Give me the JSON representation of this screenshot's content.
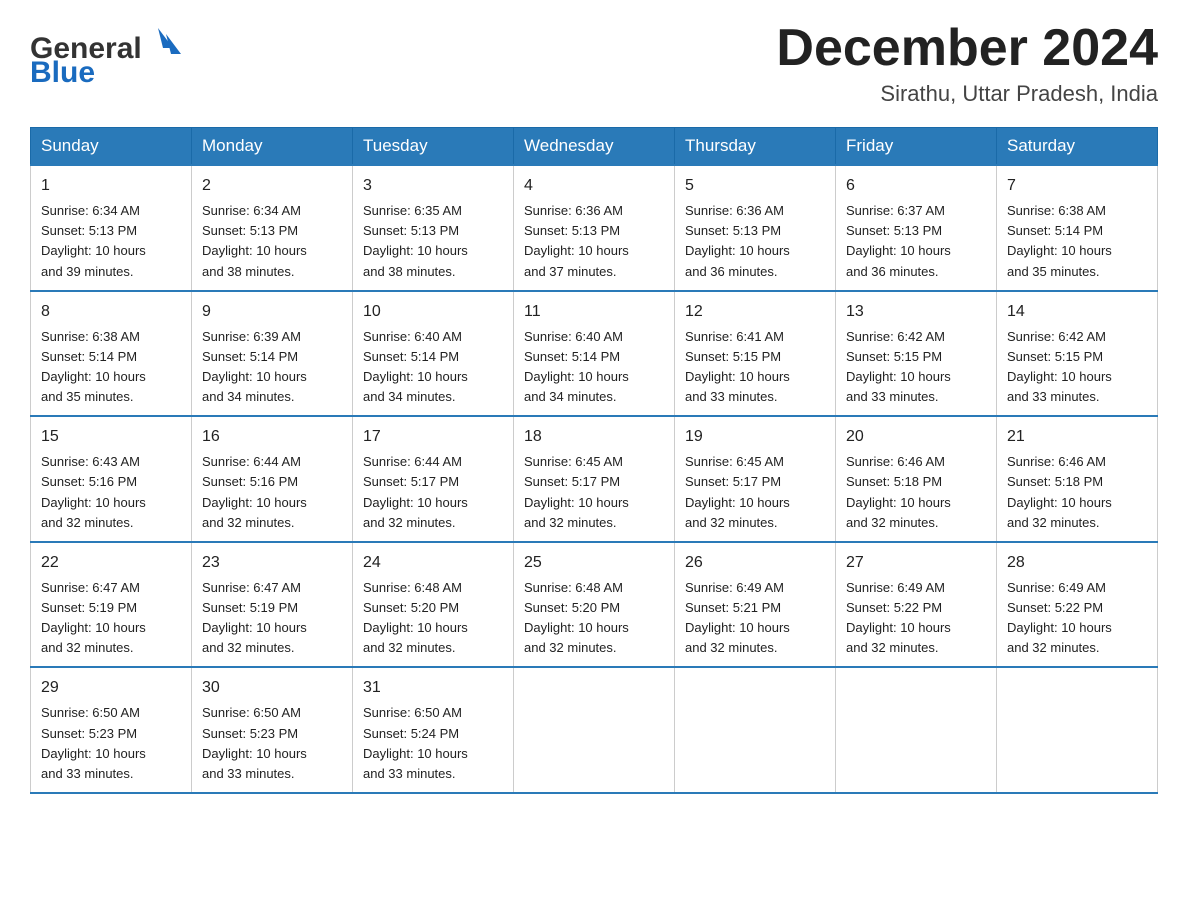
{
  "header": {
    "logo_general": "General",
    "logo_blue": "Blue",
    "month_title": "December 2024",
    "location": "Sirathu, Uttar Pradesh, India"
  },
  "days_of_week": [
    "Sunday",
    "Monday",
    "Tuesday",
    "Wednesday",
    "Thursday",
    "Friday",
    "Saturday"
  ],
  "weeks": [
    [
      {
        "day": "1",
        "sunrise": "6:34 AM",
        "sunset": "5:13 PM",
        "daylight": "10 hours and 39 minutes."
      },
      {
        "day": "2",
        "sunrise": "6:34 AM",
        "sunset": "5:13 PM",
        "daylight": "10 hours and 38 minutes."
      },
      {
        "day": "3",
        "sunrise": "6:35 AM",
        "sunset": "5:13 PM",
        "daylight": "10 hours and 38 minutes."
      },
      {
        "day": "4",
        "sunrise": "6:36 AM",
        "sunset": "5:13 PM",
        "daylight": "10 hours and 37 minutes."
      },
      {
        "day": "5",
        "sunrise": "6:36 AM",
        "sunset": "5:13 PM",
        "daylight": "10 hours and 36 minutes."
      },
      {
        "day": "6",
        "sunrise": "6:37 AM",
        "sunset": "5:13 PM",
        "daylight": "10 hours and 36 minutes."
      },
      {
        "day": "7",
        "sunrise": "6:38 AM",
        "sunset": "5:14 PM",
        "daylight": "10 hours and 35 minutes."
      }
    ],
    [
      {
        "day": "8",
        "sunrise": "6:38 AM",
        "sunset": "5:14 PM",
        "daylight": "10 hours and 35 minutes."
      },
      {
        "day": "9",
        "sunrise": "6:39 AM",
        "sunset": "5:14 PM",
        "daylight": "10 hours and 34 minutes."
      },
      {
        "day": "10",
        "sunrise": "6:40 AM",
        "sunset": "5:14 PM",
        "daylight": "10 hours and 34 minutes."
      },
      {
        "day": "11",
        "sunrise": "6:40 AM",
        "sunset": "5:14 PM",
        "daylight": "10 hours and 34 minutes."
      },
      {
        "day": "12",
        "sunrise": "6:41 AM",
        "sunset": "5:15 PM",
        "daylight": "10 hours and 33 minutes."
      },
      {
        "day": "13",
        "sunrise": "6:42 AM",
        "sunset": "5:15 PM",
        "daylight": "10 hours and 33 minutes."
      },
      {
        "day": "14",
        "sunrise": "6:42 AM",
        "sunset": "5:15 PM",
        "daylight": "10 hours and 33 minutes."
      }
    ],
    [
      {
        "day": "15",
        "sunrise": "6:43 AM",
        "sunset": "5:16 PM",
        "daylight": "10 hours and 32 minutes."
      },
      {
        "day": "16",
        "sunrise": "6:44 AM",
        "sunset": "5:16 PM",
        "daylight": "10 hours and 32 minutes."
      },
      {
        "day": "17",
        "sunrise": "6:44 AM",
        "sunset": "5:17 PM",
        "daylight": "10 hours and 32 minutes."
      },
      {
        "day": "18",
        "sunrise": "6:45 AM",
        "sunset": "5:17 PM",
        "daylight": "10 hours and 32 minutes."
      },
      {
        "day": "19",
        "sunrise": "6:45 AM",
        "sunset": "5:17 PM",
        "daylight": "10 hours and 32 minutes."
      },
      {
        "day": "20",
        "sunrise": "6:46 AM",
        "sunset": "5:18 PM",
        "daylight": "10 hours and 32 minutes."
      },
      {
        "day": "21",
        "sunrise": "6:46 AM",
        "sunset": "5:18 PM",
        "daylight": "10 hours and 32 minutes."
      }
    ],
    [
      {
        "day": "22",
        "sunrise": "6:47 AM",
        "sunset": "5:19 PM",
        "daylight": "10 hours and 32 minutes."
      },
      {
        "day": "23",
        "sunrise": "6:47 AM",
        "sunset": "5:19 PM",
        "daylight": "10 hours and 32 minutes."
      },
      {
        "day": "24",
        "sunrise": "6:48 AM",
        "sunset": "5:20 PM",
        "daylight": "10 hours and 32 minutes."
      },
      {
        "day": "25",
        "sunrise": "6:48 AM",
        "sunset": "5:20 PM",
        "daylight": "10 hours and 32 minutes."
      },
      {
        "day": "26",
        "sunrise": "6:49 AM",
        "sunset": "5:21 PM",
        "daylight": "10 hours and 32 minutes."
      },
      {
        "day": "27",
        "sunrise": "6:49 AM",
        "sunset": "5:22 PM",
        "daylight": "10 hours and 32 minutes."
      },
      {
        "day": "28",
        "sunrise": "6:49 AM",
        "sunset": "5:22 PM",
        "daylight": "10 hours and 32 minutes."
      }
    ],
    [
      {
        "day": "29",
        "sunrise": "6:50 AM",
        "sunset": "5:23 PM",
        "daylight": "10 hours and 33 minutes."
      },
      {
        "day": "30",
        "sunrise": "6:50 AM",
        "sunset": "5:23 PM",
        "daylight": "10 hours and 33 minutes."
      },
      {
        "day": "31",
        "sunrise": "6:50 AM",
        "sunset": "5:24 PM",
        "daylight": "10 hours and 33 minutes."
      },
      null,
      null,
      null,
      null
    ]
  ],
  "labels": {
    "sunrise": "Sunrise:",
    "sunset": "Sunset:",
    "daylight": "Daylight:"
  }
}
